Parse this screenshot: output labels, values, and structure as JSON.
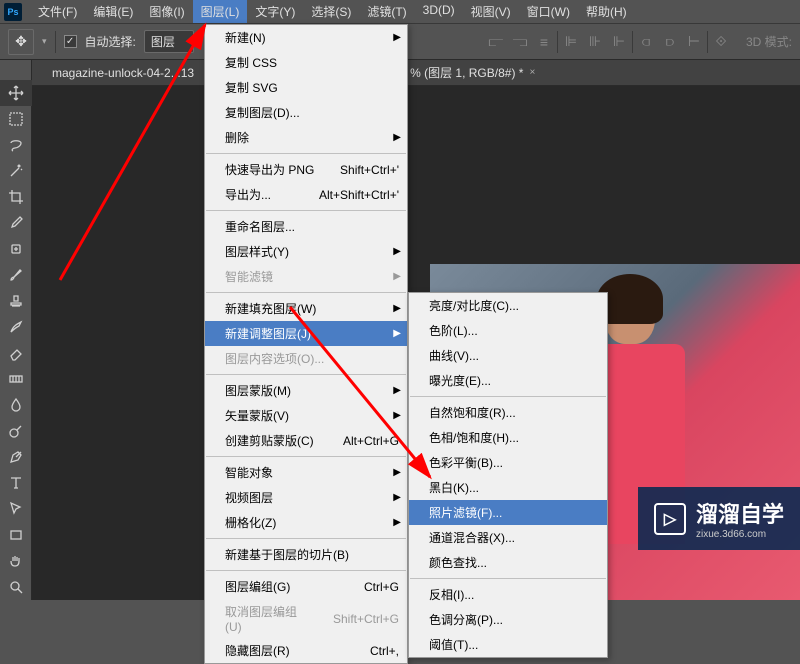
{
  "app": {
    "logo": "Ps"
  },
  "menubar": {
    "items": [
      "文件(F)",
      "编辑(E)",
      "图像(I)",
      "图层(L)",
      "文字(Y)",
      "选择(S)",
      "滤镜(T)",
      "3D(D)",
      "视图(V)",
      "窗口(W)",
      "帮助(H)"
    ],
    "active_index": 3
  },
  "optionsbar": {
    "auto_select": "自动选择:",
    "layer_label": "图层",
    "mode_label": "3D 模式:"
  },
  "tabs": {
    "tab1": "magazine-unlock-04-2.  .13",
    "tab2": "% (图层 1, RGB/8#) *"
  },
  "layer_menu": {
    "items": [
      {
        "label": "新建(N)",
        "arrow": true
      },
      {
        "label": "复制 CSS"
      },
      {
        "label": "复制 SVG"
      },
      {
        "label": "复制图层(D)..."
      },
      {
        "label": "删除",
        "arrow": true
      },
      {
        "sep": true
      },
      {
        "label": "快速导出为 PNG",
        "shortcut": "Shift+Ctrl+'"
      },
      {
        "label": "导出为...",
        "shortcut": "Alt+Shift+Ctrl+'"
      },
      {
        "sep": true
      },
      {
        "label": "重命名图层..."
      },
      {
        "label": "图层样式(Y)",
        "arrow": true
      },
      {
        "label": "智能滤镜",
        "disabled": true,
        "arrow": true
      },
      {
        "sep": true
      },
      {
        "label": "新建填充图层(W)",
        "arrow": true
      },
      {
        "label": "新建调整图层(J)",
        "arrow": true,
        "highlight": true
      },
      {
        "label": "图层内容选项(O)...",
        "disabled": true
      },
      {
        "sep": true
      },
      {
        "label": "图层蒙版(M)",
        "arrow": true
      },
      {
        "label": "矢量蒙版(V)",
        "arrow": true
      },
      {
        "label": "创建剪贴蒙版(C)",
        "shortcut": "Alt+Ctrl+G"
      },
      {
        "sep": true
      },
      {
        "label": "智能对象",
        "arrow": true
      },
      {
        "label": "视频图层",
        "arrow": true
      },
      {
        "label": "栅格化(Z)",
        "arrow": true
      },
      {
        "sep": true
      },
      {
        "label": "新建基于图层的切片(B)"
      },
      {
        "sep": true
      },
      {
        "label": "图层编组(G)",
        "shortcut": "Ctrl+G"
      },
      {
        "label": "取消图层编组(U)",
        "shortcut": "Shift+Ctrl+G",
        "disabled": true
      },
      {
        "label": "隐藏图层(R)",
        "shortcut": "Ctrl+,"
      }
    ]
  },
  "submenu": {
    "items": [
      {
        "label": "亮度/对比度(C)..."
      },
      {
        "label": "色阶(L)..."
      },
      {
        "label": "曲线(V)..."
      },
      {
        "label": "曝光度(E)..."
      },
      {
        "sep": true
      },
      {
        "label": "自然饱和度(R)..."
      },
      {
        "label": "色相/饱和度(H)..."
      },
      {
        "label": "色彩平衡(B)..."
      },
      {
        "label": "黑白(K)..."
      },
      {
        "label": "照片滤镜(F)...",
        "highlight": true
      },
      {
        "label": "通道混合器(X)..."
      },
      {
        "label": "颜色查找..."
      },
      {
        "sep": true
      },
      {
        "label": "反相(I)..."
      },
      {
        "label": "色调分离(P)..."
      },
      {
        "label": "阈值(T)..."
      }
    ]
  },
  "watermark": {
    "text": "溜溜自学",
    "sub": "zixue.3d66.com",
    "play": "▷"
  }
}
